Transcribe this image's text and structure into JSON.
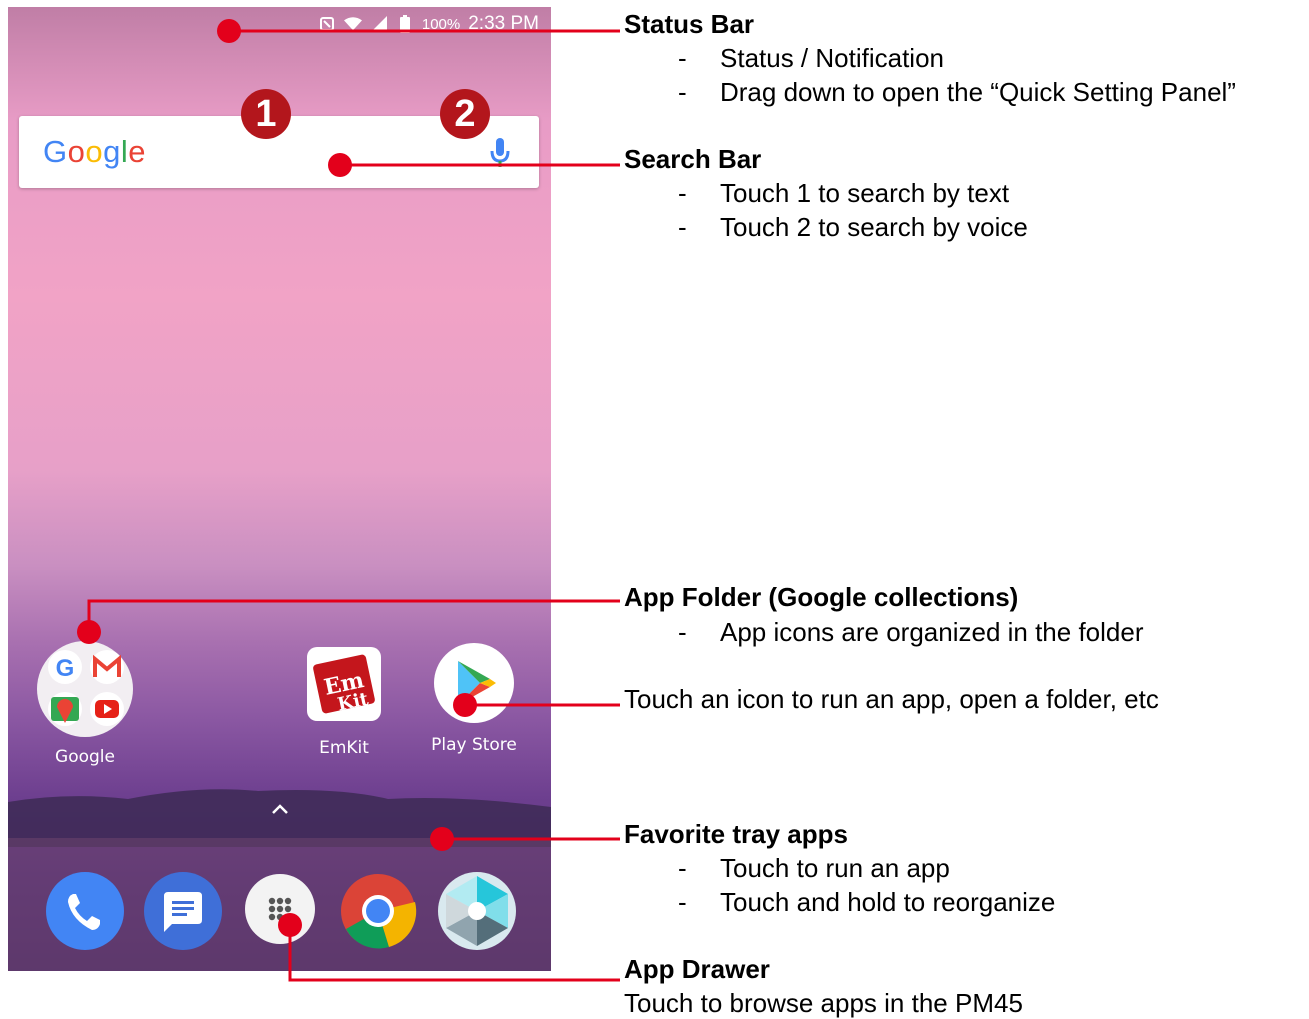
{
  "phone": {
    "status_bar": {
      "battery_percent": "100%",
      "time": "2:33 PM",
      "icons": [
        "nfc-icon",
        "wifi-icon",
        "signal-icon",
        "battery-icon"
      ]
    },
    "search": {
      "logo_text": "Google",
      "mic_icon": "mic-icon"
    },
    "badges": {
      "one": "1",
      "two": "2"
    },
    "apps": [
      {
        "label": "Google",
        "icon": "folder-google-collections-icon"
      },
      {
        "label": "EmKit",
        "icon": "emkit-icon"
      },
      {
        "label": "Play Store",
        "icon": "play-store-icon"
      }
    ],
    "dock": {
      "icons": [
        "phone-icon",
        "messages-icon",
        "app-drawer-icon",
        "chrome-icon",
        "camera-icon"
      ]
    },
    "colors": {
      "callout_red": "#e3001b",
      "badge_red": "#b3161c"
    }
  },
  "callouts": {
    "status_bar": {
      "title": "Status Bar",
      "bullets": [
        "Status / Notification",
        "Drag down to open the “Quick Setting Panel”"
      ]
    },
    "search_bar": {
      "title": "Search Bar",
      "bullets": [
        "Touch 1 to search by text",
        "Touch 2 to search by voice"
      ]
    },
    "app_folder": {
      "title": "App Folder (Google collections)",
      "bullets": [
        "App icons are organized in the folder"
      ]
    },
    "touch_icon": {
      "text": "Touch an icon to run an app, open a folder, etc"
    },
    "favorite_tray": {
      "title": "Favorite tray apps",
      "bullets": [
        "Touch to run an app",
        "Touch and hold to reorganize"
      ]
    },
    "app_drawer": {
      "title": "App Drawer",
      "text": "Touch to browse apps in the PM45"
    }
  }
}
